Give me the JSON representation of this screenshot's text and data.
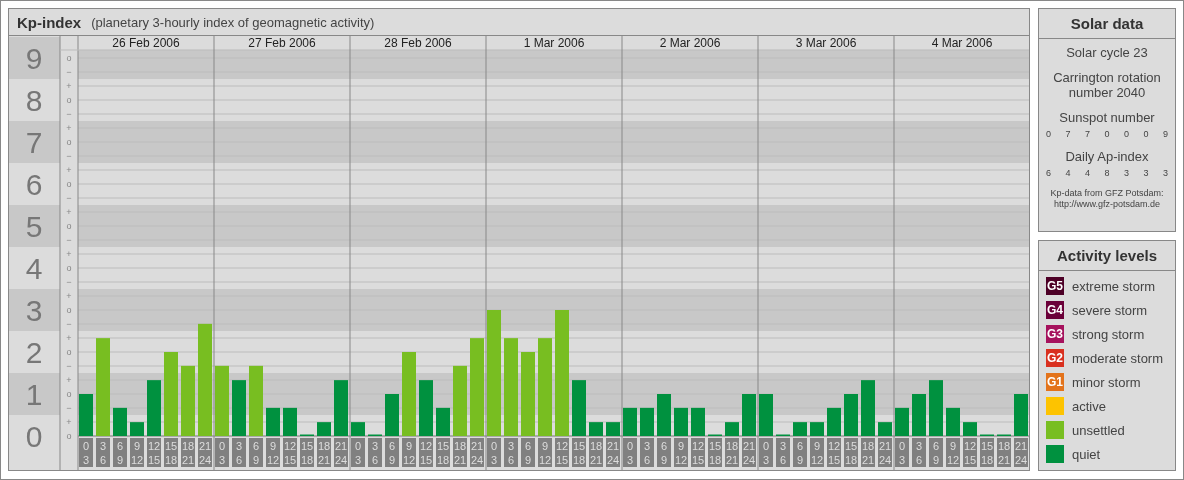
{
  "kp_panel": {
    "title": "Kp-index",
    "subtitle": "(planetary 3-hourly index of geomagnetic activity)",
    "days": [
      "26 Feb 2006",
      "27 Feb 2006",
      "28 Feb 2006",
      "1 Mar 2006",
      "2 Mar 2006",
      "3 Mar 2006",
      "4 Mar 2006"
    ],
    "minor_ticks": [
      "o",
      "−",
      "+",
      "o",
      "−",
      "+",
      "o",
      "−",
      "+",
      "o",
      "−",
      "+",
      "o",
      "−",
      "+",
      "o",
      "−",
      "+",
      "o",
      "−",
      "+",
      "o",
      "−",
      "+",
      "o",
      "−",
      "+",
      "o"
    ],
    "chart_data": {
      "type": "bar",
      "stacked": true,
      "grid": true,
      "ylim": [
        0,
        9
      ],
      "yticks": [
        0,
        1,
        2,
        3,
        4,
        5,
        6,
        7,
        8,
        9
      ],
      "categories": [
        "0 3",
        "3 6",
        "6 9",
        "9 12",
        "12 15",
        "15 18",
        "18 21",
        "21 24",
        "0 3",
        "3 6",
        "6 9",
        "9 12",
        "12 15",
        "15 18",
        "18 21",
        "21 24",
        "0 3",
        "3 6",
        "6 9",
        "9 12",
        "12 15",
        "15 18",
        "18 21",
        "21 24",
        "0 3",
        "3 6",
        "6 9",
        "9 12",
        "12 15",
        "15 18",
        "18 21",
        "21 24",
        "0 3",
        "3 6",
        "6 9",
        "9 12",
        "12 15",
        "15 18",
        "18 21",
        "21 24",
        "0 3",
        "3 6",
        "6 9",
        "9 12",
        "12 15",
        "15 18",
        "18 21",
        "21 24",
        "0 3",
        "3 6",
        "6 9",
        "9 12",
        "12 15",
        "15 18",
        "18 21",
        "21 24"
      ],
      "series": [
        {
          "color": "#00913f",
          "values": [
            1,
            null,
            0.67,
            0.33,
            1.33,
            null,
            null,
            null,
            null,
            1.33,
            null,
            0.67,
            0.67,
            0,
            0.33,
            1.33,
            0.33,
            0,
            1,
            null,
            1.33,
            0.67,
            null,
            null,
            null,
            null,
            null,
            null,
            null,
            1.33,
            0.33,
            0.33,
            0.67,
            0.67,
            1,
            0.67,
            0.67,
            0,
            0.33,
            1,
            1,
            0,
            0.33,
            0.33,
            0.67,
            1,
            1.33,
            0.33,
            0.67,
            1,
            1.33,
            0.67,
            0.33,
            0,
            0,
            1
          ]
        },
        {
          "color": "#78be21",
          "values": [
            null,
            2.33,
            null,
            null,
            null,
            2,
            1.67,
            2.67,
            1.67,
            null,
            1.67,
            null,
            null,
            null,
            null,
            null,
            null,
            null,
            null,
            2,
            null,
            null,
            1.67,
            2.33,
            3,
            2.33,
            2,
            2.33,
            3,
            null,
            null,
            null,
            null,
            null,
            null,
            null,
            null,
            null,
            null,
            null,
            null,
            null,
            null,
            null,
            null,
            null,
            null,
            null,
            null,
            null,
            null,
            null,
            null,
            null,
            null,
            null
          ]
        }
      ]
    }
  },
  "solar_data": {
    "title": "Solar data",
    "cycle": "Solar cycle 23",
    "rotation": "Carrington rotation number 2040",
    "sunspot_label": "Sunspot number",
    "sunspot_values": [
      "0",
      "7",
      "7",
      "0",
      "0",
      "0",
      "9"
    ],
    "ap_label": "Daily Ap-index",
    "ap_values": [
      "6",
      "4",
      "4",
      "8",
      "3",
      "3",
      "3"
    ],
    "credit": "Kp-data from GFZ Potsdam:",
    "credit_link": "http://www.gfz-potsdam.de"
  },
  "activity_levels": {
    "title": "Activity levels",
    "items": [
      {
        "badge": "G5",
        "label": "extreme storm",
        "color": "#4d0026"
      },
      {
        "badge": "G4",
        "label": "severe storm",
        "color": "#6b0039"
      },
      {
        "badge": "G3",
        "label": "strong storm",
        "color": "#a6125d"
      },
      {
        "badge": "G2",
        "label": "moderate storm",
        "color": "#d9301f"
      },
      {
        "badge": "G1",
        "label": "minor storm",
        "color": "#e3731b"
      },
      {
        "label": "active",
        "color": "#fdc300"
      },
      {
        "label": "unsettled",
        "color": "#78be21"
      },
      {
        "label": "quiet",
        "color": "#00913f"
      }
    ]
  }
}
